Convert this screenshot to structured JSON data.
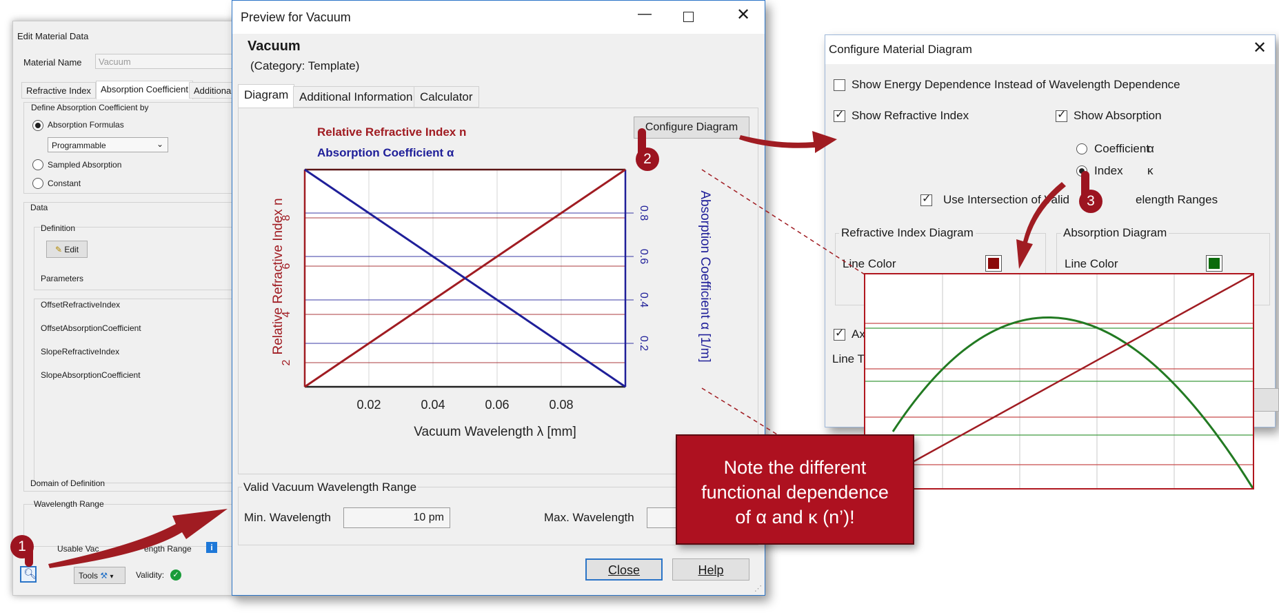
{
  "edit_window": {
    "title": "Edit Material Data",
    "material_name_label": "Material Name",
    "material_name_value": "Vacuum",
    "tabs": [
      "Refractive Index",
      "Absorption Coefficient",
      "Additional"
    ],
    "define_label": "Define Absorption Coefficient by",
    "option_formulas": "Absorption Formulas",
    "formula_select": "Programmable",
    "option_sampled": "Sampled Absorption",
    "option_constant": "Constant",
    "data_label": "Data",
    "definition_label": "Definition",
    "edit_button": "Edit",
    "parameters_label": "Parameters",
    "parameters": [
      "OffsetRefractiveIndex",
      "OffsetAbsorptionCoefficient",
      "SlopeRefractiveIndex",
      "SlopeAbsorptionCoefficient"
    ],
    "domain_label": "Domain of Definition",
    "wavelength_range_label": "Wavelength Range",
    "usable_range_label": "Usable Vac",
    "usable_range_label_tail": "ength Range",
    "tools_label": "Tools",
    "validity_label": "Validity:"
  },
  "preview_window": {
    "title": "Preview for Vacuum",
    "heading": "Vacuum",
    "category": "(Category: Template)",
    "tabs": [
      "Diagram",
      "Additional Information",
      "Calculator"
    ],
    "configure_button": "Configure Diagram",
    "legend_n": "Relative Refractive Index n",
    "legend_alpha": "Absorption Coefficient α",
    "valid_range_label": "Valid Vacuum Wavelength Range",
    "min_wavelength_label": "Min. Wavelength",
    "min_wavelength_value": "10 pm",
    "max_wavelength_label": "Max. Wavelength",
    "close_button": "Close",
    "help_button": "Help",
    "colors": {
      "n": "#a01c22",
      "alpha": "#1f1f99"
    }
  },
  "chart_data": {
    "type": "line",
    "xlabel": "Vacuum Wavelength λ [mm]",
    "ylabel": "Relative Refractive Index n",
    "y2label": "Absorption Coefficient α [1/m]",
    "x_ticks": [
      "0.02",
      "0.04",
      "0.06",
      "0.08"
    ],
    "y_ticks": [
      "2",
      "4",
      "6",
      "8"
    ],
    "y2_ticks": [
      "0.2",
      "0.4",
      "0.6",
      "0.8"
    ],
    "xlim": [
      0,
      0.1
    ],
    "ylim": [
      1,
      10
    ],
    "y2lim": [
      0,
      1
    ],
    "series": [
      {
        "name": "Relative Refractive Index n",
        "axis": "left",
        "x": [
          0,
          0.1
        ],
        "y": [
          1,
          10
        ]
      },
      {
        "name": "Absorption Coefficient α",
        "axis": "right",
        "x": [
          0,
          0.1
        ],
        "y": [
          1,
          0
        ]
      }
    ]
  },
  "config_window": {
    "title": "Configure Material Diagram",
    "show_energy": "Show Energy Dependence Instead of Wavelength Dependence",
    "show_refractive": "Show Refractive Index",
    "show_absorption": "Show Absorption",
    "coefficient_label": "Coefficient",
    "coefficient_symbol": "α",
    "index_label": "Index",
    "index_symbol": "κ",
    "use_intersection": "Use Intersection of Valid",
    "use_intersection_tail": "elength Ranges",
    "refractive_diagram_label": "Refractive Index Diagram",
    "absorption_diagram_label": "Absorption Diagram",
    "line_color_label": "Line Color",
    "axis_fragment": "Ax",
    "line_fragment": "Line T",
    "refractive_color": "#8b0a0a",
    "absorption_color": "#0b6b0b"
  },
  "note": {
    "line1": "Note the different",
    "line2": "functional dependence",
    "line3": "of α and κ (n’)!"
  },
  "markers": [
    "1",
    "2",
    "3"
  ]
}
